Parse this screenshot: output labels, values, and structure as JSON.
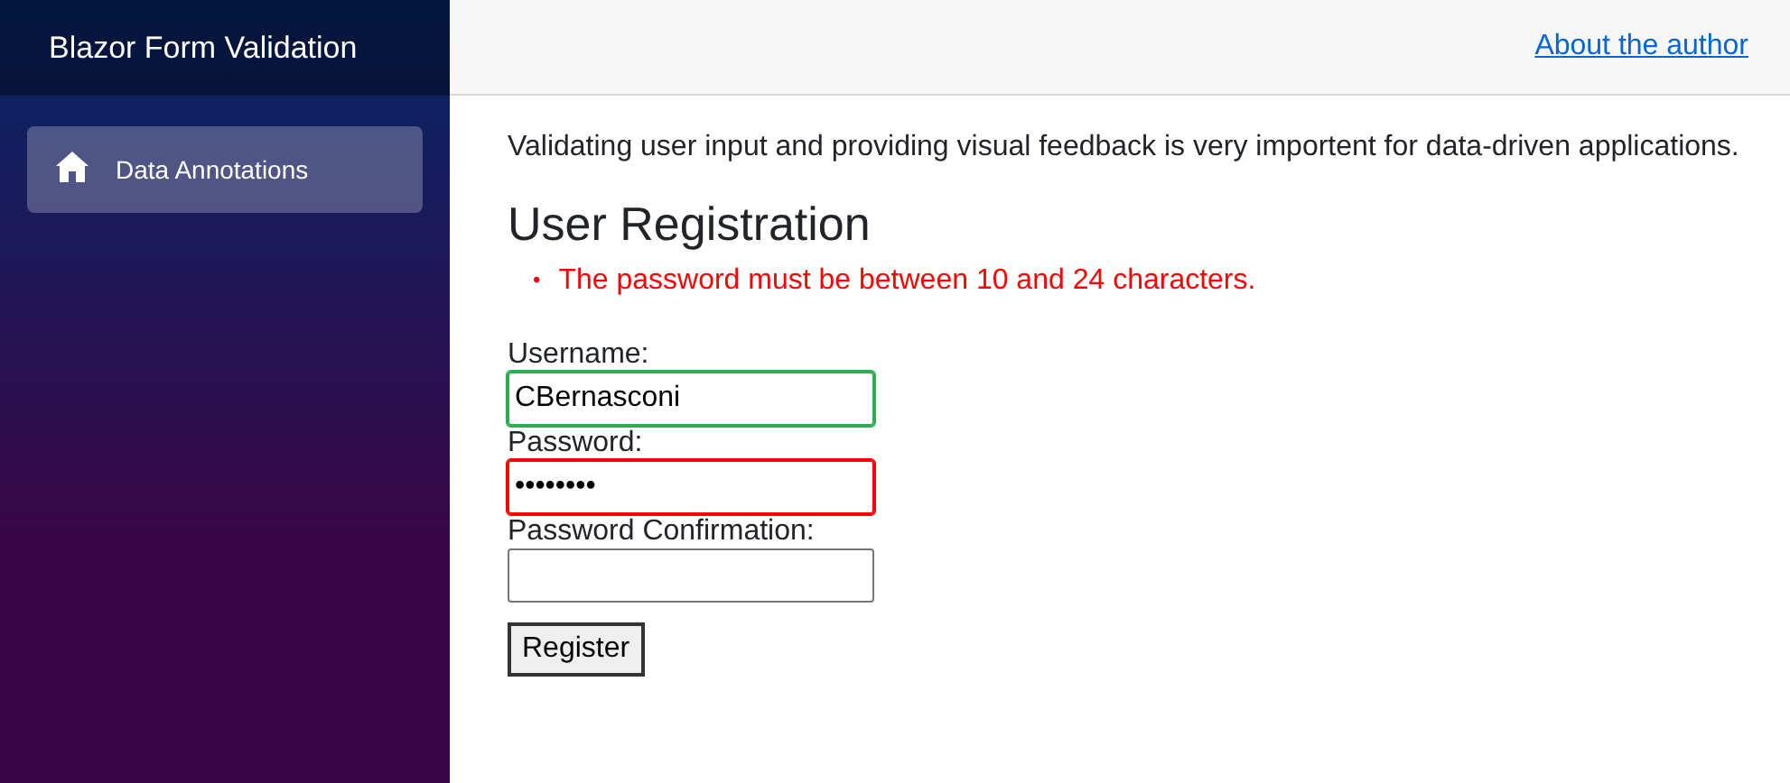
{
  "sidebar": {
    "title": "Blazor Form Validation",
    "items": [
      {
        "label": "Data Annotations",
        "selected": true
      }
    ]
  },
  "top_bar": {
    "link": "About the author"
  },
  "intro": "Validating user input and providing visual feedback is very importent for data-driven applications.",
  "heading": "User Registration",
  "validation_errors": [
    {
      "bullet": "•",
      "text": "The password must be between 10 and 24 characters."
    }
  ],
  "fields": [
    {
      "label": "Username:",
      "value": "CBernasconi",
      "valid": true,
      "invalid": false
    },
    {
      "label": "Password:",
      "value": "••••••••",
      "valid": false,
      "invalid": true
    },
    {
      "label": "Password Confirmation:",
      "valid": false,
      "invalid": false
    }
  ],
  "buttons": [
    "Register"
  ]
}
